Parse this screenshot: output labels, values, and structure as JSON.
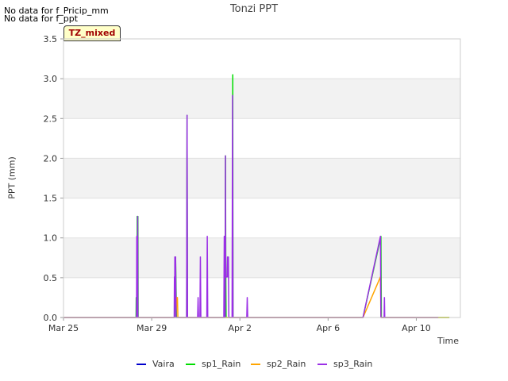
{
  "notes": [
    "No data for f_Pricip_mm",
    "No data for f_ppt"
  ],
  "badge": "TZ_mixed",
  "chart_data": {
    "type": "line",
    "title": "Tonzi PPT",
    "xlabel": "Time",
    "ylabel": "PPT (mm)",
    "x_ticks": [
      "Mar 25",
      "Mar 29",
      "Apr 2",
      "Apr 6",
      "Apr 10"
    ],
    "y_ticks": [
      "0.0",
      "0.5",
      "1.0",
      "1.5",
      "2.0",
      "2.5",
      "3.0",
      "3.5"
    ],
    "xlim": [
      "2024-03-25T00:00",
      "2024-04-12T00:00"
    ],
    "ylim": [
      0,
      3.5
    ],
    "grid": true,
    "legend_position": "bottom",
    "series": [
      {
        "name": "Vaira",
        "color": "#0000cc",
        "points": []
      },
      {
        "name": "sp1_Rain",
        "color": "#00dd00",
        "points": [
          [
            "2024-03-25T00:00",
            0
          ],
          [
            "2024-03-28T07:00",
            0
          ],
          [
            "2024-03-28T07:10",
            0.25
          ],
          [
            "2024-03-28T07:30",
            0
          ],
          [
            "2024-03-28T08:00",
            0
          ],
          [
            "2024-03-28T08:15",
            1.27
          ],
          [
            "2024-03-28T08:30",
            0
          ],
          [
            "2024-03-28T09:00",
            1.27
          ],
          [
            "2024-03-28T09:15",
            0
          ],
          [
            "2024-03-30T01:00",
            0
          ],
          [
            "2024-03-30T02:00",
            0.76
          ],
          [
            "2024-03-30T03:00",
            0
          ],
          [
            "2024-03-30T14:00",
            0
          ],
          [
            "2024-03-30T14:30",
            2.54
          ],
          [
            "2024-03-30T15:00",
            0
          ],
          [
            "2024-04-01T08:00",
            0
          ],
          [
            "2024-04-01T08:20",
            2.03
          ],
          [
            "2024-04-01T08:40",
            0.51
          ],
          [
            "2024-04-01T09:00",
            0
          ],
          [
            "2024-04-01T16:00",
            0
          ],
          [
            "2024-04-01T16:15",
            3.05
          ],
          [
            "2024-04-01T16:30",
            0
          ],
          [
            "2024-04-07T14:00",
            0
          ],
          [
            "2024-04-08T09:30",
            1.02
          ],
          [
            "2024-04-08T10:00",
            0
          ],
          [
            "2024-04-11T12:00",
            0
          ]
        ]
      },
      {
        "name": "sp2_Rain",
        "color": "#ffa500",
        "points": [
          [
            "2024-03-25T00:00",
            0
          ],
          [
            "2024-03-30T02:30",
            0
          ],
          [
            "2024-03-30T03:00",
            0.25
          ],
          [
            "2024-03-30T04:00",
            0.25
          ],
          [
            "2024-03-30T04:30",
            0
          ],
          [
            "2024-04-07T14:00",
            0
          ],
          [
            "2024-04-08T09:00",
            0.51
          ],
          [
            "2024-04-08T09:30",
            0
          ],
          [
            "2024-04-11T12:00",
            0
          ]
        ]
      },
      {
        "name": "sp3_Rain",
        "color": "#9b30e6",
        "points": [
          [
            "2024-03-25T00:00",
            0
          ],
          [
            "2024-03-28T07:30",
            0
          ],
          [
            "2024-03-28T07:45",
            1.02
          ],
          [
            "2024-03-28T08:00",
            0
          ],
          [
            "2024-03-28T08:30",
            0
          ],
          [
            "2024-03-28T08:45",
            1.27
          ],
          [
            "2024-03-28T09:00",
            0
          ],
          [
            "2024-03-30T00:30",
            0
          ],
          [
            "2024-03-30T00:45",
            0.51
          ],
          [
            "2024-03-30T01:00",
            0
          ],
          [
            "2024-03-30T01:10",
            0.76
          ],
          [
            "2024-03-30T01:30",
            0.25
          ],
          [
            "2024-03-30T02:00",
            0.76
          ],
          [
            "2024-03-30T02:30",
            0
          ],
          [
            "2024-03-30T14:00",
            0
          ],
          [
            "2024-03-30T14:30",
            2.54
          ],
          [
            "2024-03-30T15:00",
            0
          ],
          [
            "2024-03-31T02:00",
            0
          ],
          [
            "2024-03-31T02:30",
            0.25
          ],
          [
            "2024-03-31T03:00",
            0
          ],
          [
            "2024-03-31T04:30",
            0
          ],
          [
            "2024-03-31T05:00",
            0.76
          ],
          [
            "2024-03-31T05:30",
            0
          ],
          [
            "2024-03-31T12:00",
            0
          ],
          [
            "2024-03-31T12:30",
            1.02
          ],
          [
            "2024-03-31T13:00",
            0
          ],
          [
            "2024-04-01T06:30",
            0
          ],
          [
            "2024-04-01T07:00",
            1.02
          ],
          [
            "2024-04-01T07:20",
            0
          ],
          [
            "2024-04-01T08:00",
            0
          ],
          [
            "2024-04-01T08:15",
            2.03
          ],
          [
            "2024-04-01T08:30",
            0.51
          ],
          [
            "2024-04-01T10:00",
            0.51
          ],
          [
            "2024-04-01T10:30",
            0.76
          ],
          [
            "2024-04-01T11:00",
            0.51
          ],
          [
            "2024-04-01T11:30",
            0.76
          ],
          [
            "2024-04-01T12:00",
            0
          ],
          [
            "2024-04-01T15:30",
            0
          ],
          [
            "2024-04-01T16:00",
            2.79
          ],
          [
            "2024-04-01T16:30",
            0
          ],
          [
            "2024-04-02T07:30",
            0
          ],
          [
            "2024-04-02T08:00",
            0.25
          ],
          [
            "2024-04-02T08:30",
            0
          ],
          [
            "2024-04-07T14:00",
            0
          ],
          [
            "2024-04-08T09:00",
            1.02
          ],
          [
            "2024-04-08T09:30",
            0
          ],
          [
            "2024-04-08T13:00",
            0
          ],
          [
            "2024-04-08T13:20",
            0.25
          ],
          [
            "2024-04-08T13:40",
            0
          ],
          [
            "2024-04-11T00:00",
            0
          ]
        ]
      }
    ]
  }
}
